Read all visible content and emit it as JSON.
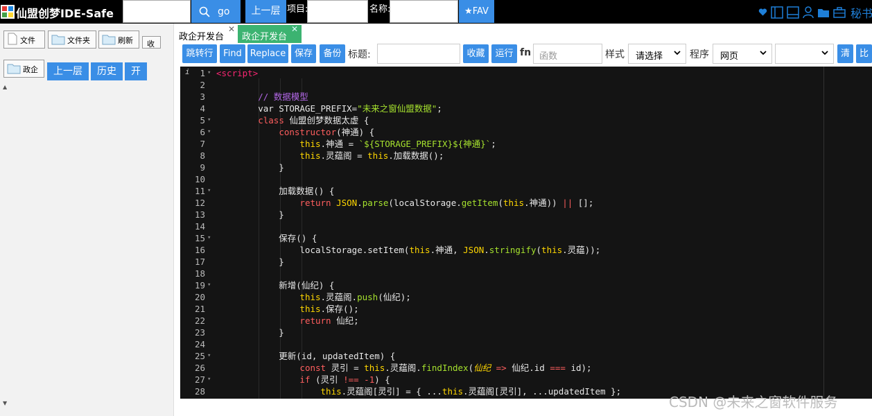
{
  "topbar": {
    "brand": "仙盟创梦IDE-Safe",
    "go_label": "go",
    "up_label": "上一层",
    "project_label": "项目:",
    "name_label": "名称:",
    "fav_label": "★FAV",
    "secret_label": "秘书"
  },
  "left": {
    "file_btn": "文件",
    "folder_btn": "文件夹",
    "refresh_btn": "刷新",
    "collapse_btn": "收",
    "gov_btn": "政企",
    "up_btn": "上一层",
    "history_btn": "历史",
    "open_btn": "开"
  },
  "tabs": [
    {
      "label": "政企开发台",
      "close": "✕"
    },
    {
      "label": "政企开发台",
      "close": "✕"
    }
  ],
  "toolbar": {
    "goto_btn": "跳转行",
    "find_btn": "Find",
    "replace_btn": "Replace",
    "save_btn": "保存",
    "backup_btn": "备份",
    "title_label": "标题:",
    "collect_btn": "收藏",
    "run_btn": "运行",
    "fn_label": "fn",
    "func_placeholder": "函数",
    "style_label": "样式",
    "style_value": "请选择",
    "program_label": "程序",
    "program_value": "网页",
    "clear_btn": "清",
    "compare_btn": "比"
  },
  "editor": {
    "lines": [
      {
        "n": "1",
        "fold": "▾",
        "code": "<script>"
      },
      {
        "n": "2",
        "fold": "",
        "code": ""
      },
      {
        "n": "3",
        "fold": "",
        "code": "        // 数据模型"
      },
      {
        "n": "4",
        "fold": "",
        "code": "        var STORAGE_PREFIX=\"未来之窗仙盟数据\";"
      },
      {
        "n": "5",
        "fold": "▾",
        "code": "        class 仙盟创梦数据太虚 {"
      },
      {
        "n": "6",
        "fold": "▾",
        "code": "            constructor(神通) {"
      },
      {
        "n": "7",
        "fold": "",
        "code": "                this.神通 = `${STORAGE_PREFIX}${神通}`;"
      },
      {
        "n": "8",
        "fold": "",
        "code": "                this.灵蕴阁 = this.加载数据();"
      },
      {
        "n": "9",
        "fold": "",
        "code": "            }"
      },
      {
        "n": "10",
        "fold": "",
        "code": ""
      },
      {
        "n": "11",
        "fold": "▾",
        "code": "            加载数据() {"
      },
      {
        "n": "12",
        "fold": "",
        "code": "                return JSON.parse(localStorage.getItem(this.神通)) || [];"
      },
      {
        "n": "13",
        "fold": "",
        "code": "            }"
      },
      {
        "n": "14",
        "fold": "",
        "code": ""
      },
      {
        "n": "15",
        "fold": "▾",
        "code": "            保存() {"
      },
      {
        "n": "16",
        "fold": "",
        "code": "                localStorage.setItem(this.神通, JSON.stringify(this.灵蕴));"
      },
      {
        "n": "17",
        "fold": "",
        "code": "            }"
      },
      {
        "n": "18",
        "fold": "",
        "code": ""
      },
      {
        "n": "19",
        "fold": "▾",
        "code": "            新增(仙纪) {"
      },
      {
        "n": "20",
        "fold": "",
        "code": "                this.灵蕴阁.push(仙纪);"
      },
      {
        "n": "21",
        "fold": "",
        "code": "                this.保存();"
      },
      {
        "n": "22",
        "fold": "",
        "code": "                return 仙纪;"
      },
      {
        "n": "23",
        "fold": "",
        "code": "            }"
      },
      {
        "n": "24",
        "fold": "",
        "code": ""
      },
      {
        "n": "25",
        "fold": "▾",
        "code": "            更新(id, updatedItem) {"
      },
      {
        "n": "26",
        "fold": "",
        "code": "                const 灵引 = this.灵蕴阁.findIndex(仙纪 => 仙纪.id === id);"
      },
      {
        "n": "27",
        "fold": "▾",
        "code": "                if (灵引 !== -1) {"
      },
      {
        "n": "28",
        "fold": "",
        "code": "                    this.灵蕴阁[灵引] = { ...this.灵蕴阁[灵引], ...updatedItem };"
      }
    ]
  },
  "watermark": "CSDN @未来之窗软件服务"
}
